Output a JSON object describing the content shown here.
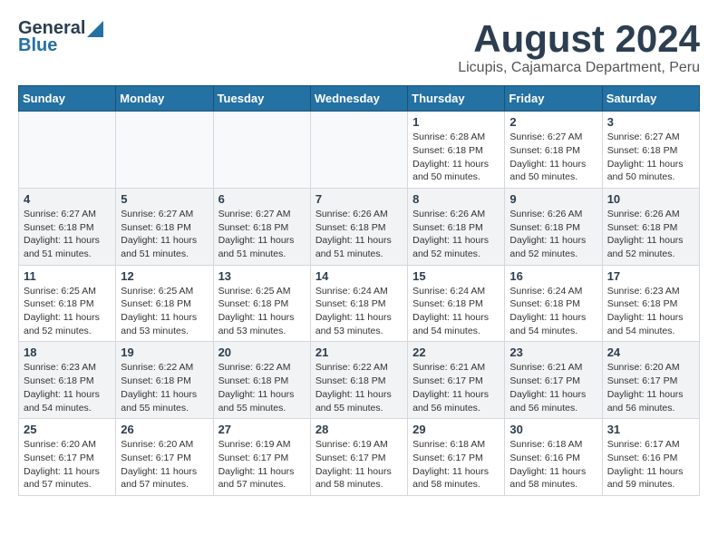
{
  "header": {
    "logo_general": "General",
    "logo_blue": "Blue",
    "month_title": "August 2024",
    "location": "Licupis, Cajamarca Department, Peru"
  },
  "weekdays": [
    "Sunday",
    "Monday",
    "Tuesday",
    "Wednesday",
    "Thursday",
    "Friday",
    "Saturday"
  ],
  "weeks": [
    [
      {
        "day": "",
        "info": ""
      },
      {
        "day": "",
        "info": ""
      },
      {
        "day": "",
        "info": ""
      },
      {
        "day": "",
        "info": ""
      },
      {
        "day": "1",
        "info": "Sunrise: 6:28 AM\nSunset: 6:18 PM\nDaylight: 11 hours\nand 50 minutes."
      },
      {
        "day": "2",
        "info": "Sunrise: 6:27 AM\nSunset: 6:18 PM\nDaylight: 11 hours\nand 50 minutes."
      },
      {
        "day": "3",
        "info": "Sunrise: 6:27 AM\nSunset: 6:18 PM\nDaylight: 11 hours\nand 50 minutes."
      }
    ],
    [
      {
        "day": "4",
        "info": "Sunrise: 6:27 AM\nSunset: 6:18 PM\nDaylight: 11 hours\nand 51 minutes."
      },
      {
        "day": "5",
        "info": "Sunrise: 6:27 AM\nSunset: 6:18 PM\nDaylight: 11 hours\nand 51 minutes."
      },
      {
        "day": "6",
        "info": "Sunrise: 6:27 AM\nSunset: 6:18 PM\nDaylight: 11 hours\nand 51 minutes."
      },
      {
        "day": "7",
        "info": "Sunrise: 6:26 AM\nSunset: 6:18 PM\nDaylight: 11 hours\nand 51 minutes."
      },
      {
        "day": "8",
        "info": "Sunrise: 6:26 AM\nSunset: 6:18 PM\nDaylight: 11 hours\nand 52 minutes."
      },
      {
        "day": "9",
        "info": "Sunrise: 6:26 AM\nSunset: 6:18 PM\nDaylight: 11 hours\nand 52 minutes."
      },
      {
        "day": "10",
        "info": "Sunrise: 6:26 AM\nSunset: 6:18 PM\nDaylight: 11 hours\nand 52 minutes."
      }
    ],
    [
      {
        "day": "11",
        "info": "Sunrise: 6:25 AM\nSunset: 6:18 PM\nDaylight: 11 hours\nand 52 minutes."
      },
      {
        "day": "12",
        "info": "Sunrise: 6:25 AM\nSunset: 6:18 PM\nDaylight: 11 hours\nand 53 minutes."
      },
      {
        "day": "13",
        "info": "Sunrise: 6:25 AM\nSunset: 6:18 PM\nDaylight: 11 hours\nand 53 minutes."
      },
      {
        "day": "14",
        "info": "Sunrise: 6:24 AM\nSunset: 6:18 PM\nDaylight: 11 hours\nand 53 minutes."
      },
      {
        "day": "15",
        "info": "Sunrise: 6:24 AM\nSunset: 6:18 PM\nDaylight: 11 hours\nand 54 minutes."
      },
      {
        "day": "16",
        "info": "Sunrise: 6:24 AM\nSunset: 6:18 PM\nDaylight: 11 hours\nand 54 minutes."
      },
      {
        "day": "17",
        "info": "Sunrise: 6:23 AM\nSunset: 6:18 PM\nDaylight: 11 hours\nand 54 minutes."
      }
    ],
    [
      {
        "day": "18",
        "info": "Sunrise: 6:23 AM\nSunset: 6:18 PM\nDaylight: 11 hours\nand 54 minutes."
      },
      {
        "day": "19",
        "info": "Sunrise: 6:22 AM\nSunset: 6:18 PM\nDaylight: 11 hours\nand 55 minutes."
      },
      {
        "day": "20",
        "info": "Sunrise: 6:22 AM\nSunset: 6:18 PM\nDaylight: 11 hours\nand 55 minutes."
      },
      {
        "day": "21",
        "info": "Sunrise: 6:22 AM\nSunset: 6:18 PM\nDaylight: 11 hours\nand 55 minutes."
      },
      {
        "day": "22",
        "info": "Sunrise: 6:21 AM\nSunset: 6:17 PM\nDaylight: 11 hours\nand 56 minutes."
      },
      {
        "day": "23",
        "info": "Sunrise: 6:21 AM\nSunset: 6:17 PM\nDaylight: 11 hours\nand 56 minutes."
      },
      {
        "day": "24",
        "info": "Sunrise: 6:20 AM\nSunset: 6:17 PM\nDaylight: 11 hours\nand 56 minutes."
      }
    ],
    [
      {
        "day": "25",
        "info": "Sunrise: 6:20 AM\nSunset: 6:17 PM\nDaylight: 11 hours\nand 57 minutes."
      },
      {
        "day": "26",
        "info": "Sunrise: 6:20 AM\nSunset: 6:17 PM\nDaylight: 11 hours\nand 57 minutes."
      },
      {
        "day": "27",
        "info": "Sunrise: 6:19 AM\nSunset: 6:17 PM\nDaylight: 11 hours\nand 57 minutes."
      },
      {
        "day": "28",
        "info": "Sunrise: 6:19 AM\nSunset: 6:17 PM\nDaylight: 11 hours\nand 58 minutes."
      },
      {
        "day": "29",
        "info": "Sunrise: 6:18 AM\nSunset: 6:17 PM\nDaylight: 11 hours\nand 58 minutes."
      },
      {
        "day": "30",
        "info": "Sunrise: 6:18 AM\nSunset: 6:16 PM\nDaylight: 11 hours\nand 58 minutes."
      },
      {
        "day": "31",
        "info": "Sunrise: 6:17 AM\nSunset: 6:16 PM\nDaylight: 11 hours\nand 59 minutes."
      }
    ]
  ]
}
